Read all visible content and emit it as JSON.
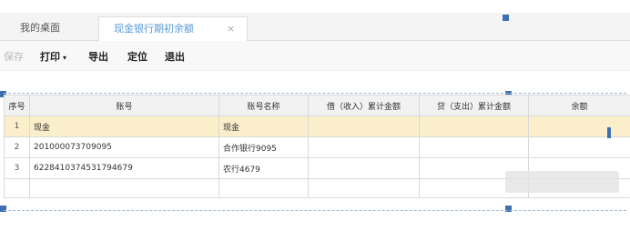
{
  "tabs": {
    "home": "我的桌面",
    "active": "现金银行期初余额",
    "close_symbol": "×"
  },
  "toolbar": {
    "save": "保存",
    "print": "打印",
    "print_caret": "▾",
    "export": "导出",
    "locate": "定位",
    "exit": "退出"
  },
  "table": {
    "headers": [
      "序号",
      "账号",
      "账号名称",
      "借（收入）累计金额",
      "贷（支出）累计金额",
      "余额"
    ],
    "rows": [
      {
        "seq": "1",
        "account": "现金",
        "name": "现金",
        "debit": "",
        "credit": "",
        "balance": ""
      },
      {
        "seq": "2",
        "account": "201000073709095",
        "name": "合作银行9095",
        "debit": "",
        "credit": "",
        "balance": ""
      },
      {
        "seq": "3",
        "account": "6228410374531794679",
        "name": "农行4679",
        "debit": "",
        "credit": "",
        "balance": ""
      }
    ]
  },
  "colors": {
    "active_tab_text": "#5b9bd5",
    "selected_row": "#fbeecb",
    "handle": "#3e6fb3"
  }
}
